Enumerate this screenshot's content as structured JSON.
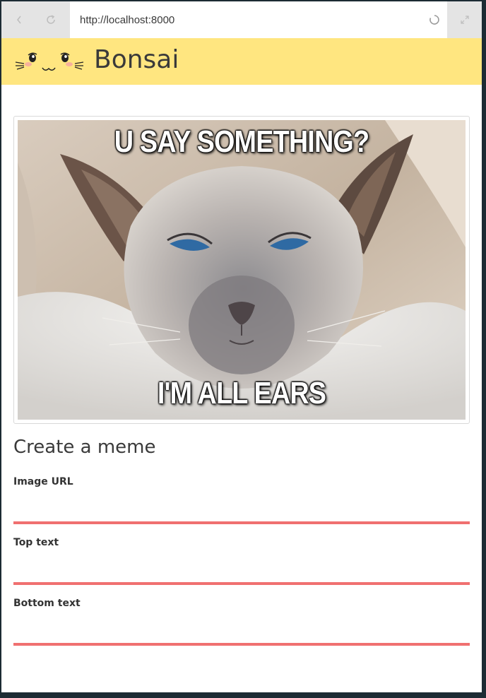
{
  "browser": {
    "url": "http://localhost:8000",
    "back_icon": "chevron-left-icon",
    "reload_icon": "reload-icon",
    "loading_icon": "spinner-icon",
    "expand_icon": "expand-icon"
  },
  "header": {
    "title": "Bonsai",
    "background": "#ffe680",
    "logo_icon": "cat-face-icon"
  },
  "meme": {
    "top_text": "U SAY SOMETHING?",
    "bottom_text": "I'M ALL EARS"
  },
  "form": {
    "title": "Create a meme",
    "image_url": {
      "label": "Image URL",
      "value": ""
    },
    "top_text": {
      "label": "Top text",
      "value": ""
    },
    "bottom_text": {
      "label": "Bottom text",
      "value": ""
    },
    "accent": "#f07070"
  }
}
